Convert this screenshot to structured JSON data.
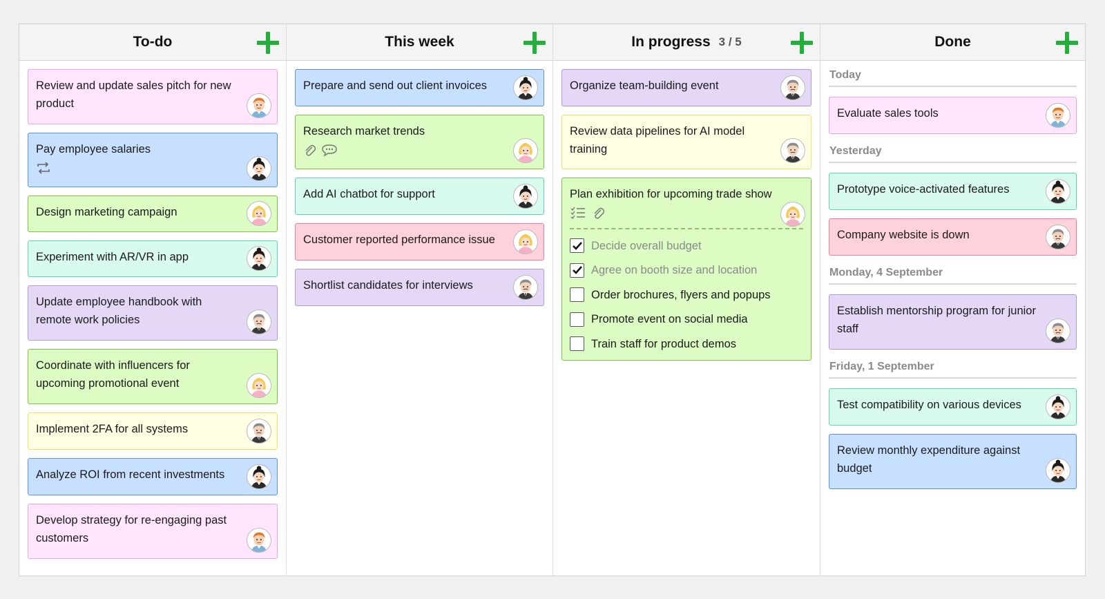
{
  "colors": {
    "pink": "#ffe6fe",
    "blue": "#c8e0ff",
    "green": "#dcfcc4",
    "mint": "#d8fbee",
    "lavender": "#e4d8f6",
    "yellow": "#fffde2",
    "rose": "#fdd2dc",
    "add_icon": "#22b03a"
  },
  "avatars": {
    "a_orange_hair_man": "orange-haired-man-avatar",
    "b_black_hair_woman": "black-haired-woman-avatar",
    "c_blonde_woman": "blonde-woman-avatar",
    "d_gray_hair_man": "gray-haired-man-avatar"
  },
  "columns": [
    {
      "title": "To-do",
      "cards": [
        {
          "text": "Review and update sales pitch for new product",
          "color": "pink",
          "avatar": "a"
        },
        {
          "text": "Pay employee salaries",
          "color": "blue",
          "avatar": "b",
          "icons": [
            "repeat-icon"
          ]
        },
        {
          "text": "Design marketing campaign",
          "color": "green",
          "avatar": "c"
        },
        {
          "text": "Experiment with AR/VR in app",
          "color": "mint",
          "avatar": "b"
        },
        {
          "text": "Update employee handbook with remote work policies",
          "color": "lavender",
          "avatar": "d"
        },
        {
          "text": "Coordinate with influencers for upcoming promotional event",
          "color": "green",
          "avatar": "c"
        },
        {
          "text": "Implement 2FA for all systems",
          "color": "yellow",
          "avatar": "d"
        },
        {
          "text": "Analyze ROI from recent investments",
          "color": "blue",
          "avatar": "b"
        },
        {
          "text": "Develop strategy for re-engaging past customers",
          "color": "pink",
          "avatar": "a"
        }
      ]
    },
    {
      "title": "This week",
      "cards": [
        {
          "text": "Prepare and send out client invoices",
          "color": "blue",
          "avatar": "b"
        },
        {
          "text": "Research market trends",
          "color": "green",
          "avatar": "c",
          "icons": [
            "paperclip-icon",
            "comment-icon"
          ]
        },
        {
          "text": "Add AI chatbot for support",
          "color": "mint",
          "avatar": "b"
        },
        {
          "text": "Customer reported performance issue",
          "color": "rose",
          "avatar": "c"
        },
        {
          "text": "Shortlist candidates for interviews",
          "color": "lavender",
          "avatar": "d"
        }
      ]
    },
    {
      "title": "In progress",
      "count": "3 / 5",
      "cards": [
        {
          "text": "Organize team-building event",
          "color": "lavender",
          "avatar": "d"
        },
        {
          "text": "Review data pipelines for AI model training",
          "color": "yellow",
          "avatar": "d"
        },
        {
          "text": "Plan exhibition for upcoming trade show",
          "color": "green",
          "avatar": "c",
          "icons": [
            "checklist-icon",
            "paperclip-icon"
          ],
          "checklist": [
            {
              "label": "Decide overall budget",
              "checked": true
            },
            {
              "label": "Agree on booth size and location",
              "checked": true
            },
            {
              "label": "Order brochures, flyers and popups",
              "checked": false
            },
            {
              "label": "Promote event on social media",
              "checked": false
            },
            {
              "label": "Train staff for product demos",
              "checked": false
            }
          ]
        }
      ]
    },
    {
      "title": "Done",
      "groups": [
        {
          "label": "Today",
          "cards": [
            {
              "text": "Evaluate sales tools",
              "color": "pink",
              "avatar": "a"
            }
          ]
        },
        {
          "label": "Yesterday",
          "cards": [
            {
              "text": "Prototype voice-activated features",
              "color": "mint",
              "avatar": "b"
            },
            {
              "text": "Company website is down",
              "color": "rose",
              "avatar": "d"
            }
          ]
        },
        {
          "label": "Monday, 4 September",
          "cards": [
            {
              "text": "Establish mentorship program for junior staff",
              "color": "lavender",
              "avatar": "d"
            }
          ]
        },
        {
          "label": "Friday, 1 September",
          "cards": [
            {
              "text": "Test compatibility on various devices",
              "color": "mint",
              "avatar": "b"
            },
            {
              "text": "Review monthly expenditure against budget",
              "color": "blue",
              "avatar": "b"
            }
          ]
        }
      ]
    }
  ]
}
